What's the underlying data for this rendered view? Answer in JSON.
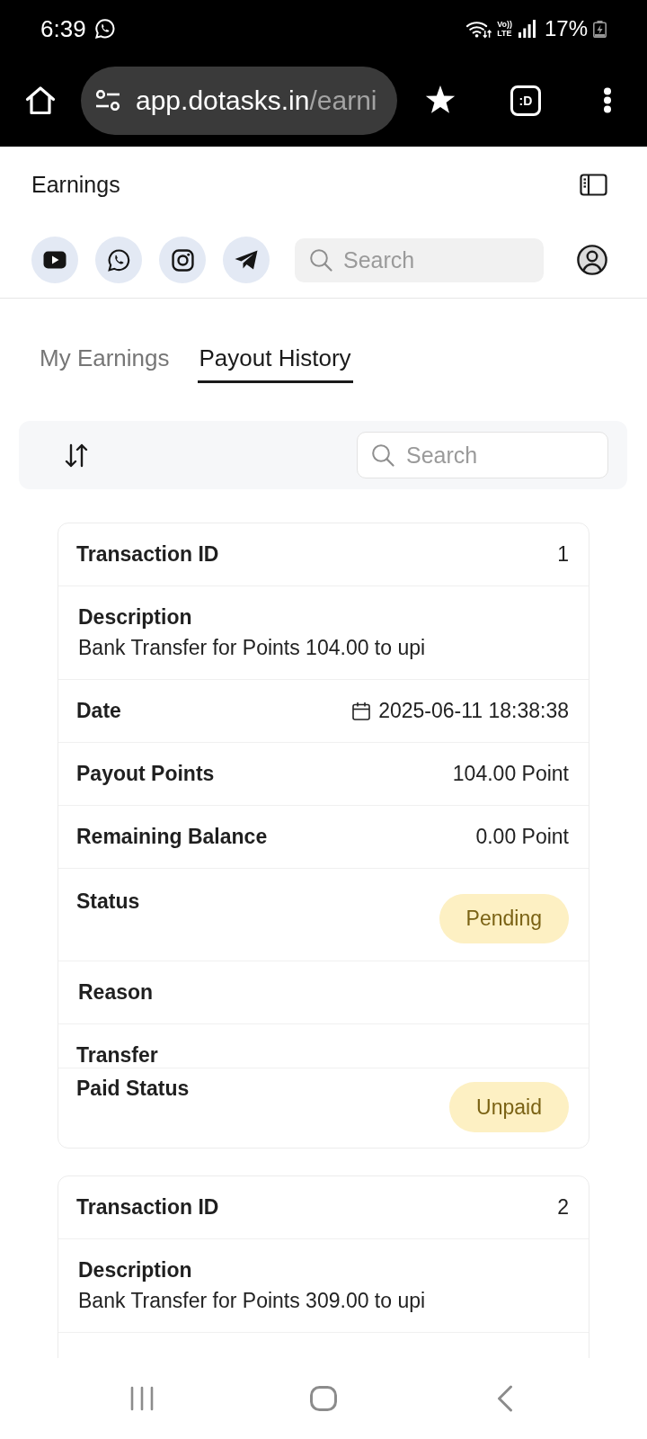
{
  "status_bar": {
    "time": "6:39",
    "network": [
      "Vo))",
      "LTE"
    ],
    "battery": "17%"
  },
  "browser": {
    "url_host": "app.dotasks.in",
    "url_path": "/earni",
    "tab_label": ":D"
  },
  "header": {
    "title": "Earnings",
    "social_links": [
      {
        "kind": "youtube"
      },
      {
        "kind": "whatsapp"
      },
      {
        "kind": "instagram"
      },
      {
        "kind": "telegram"
      }
    ],
    "search": {
      "placeholder": "Search"
    }
  },
  "tabs": [
    {
      "label": "My Earnings",
      "selected": false
    },
    {
      "label": "Payout History",
      "selected": true
    }
  ],
  "toolbar": {
    "search": {
      "placeholder": "Search"
    }
  },
  "payouts": [
    {
      "truncated": false,
      "fields": [
        {
          "kind": "text",
          "label": "Transaction ID",
          "value": "1"
        },
        {
          "kind": "stacked",
          "label": "Description",
          "value": "Bank Transfer for Points 104.00 to upi"
        },
        {
          "kind": "date",
          "label": "Date",
          "value": "2025-06-11 18:38:38"
        },
        {
          "kind": "text",
          "label": "Payout Points",
          "value": "104.00 Point"
        },
        {
          "kind": "text",
          "label": "Remaining Balance",
          "value": "0.00 Point"
        },
        {
          "kind": "badge",
          "label": "Status",
          "value": "Pending"
        },
        {
          "kind": "stacked",
          "label": "Reason"
        },
        {
          "kind": "stacked",
          "label": "Transfer",
          "overlapped": true
        },
        {
          "kind": "badge",
          "label": "Paid Status",
          "value": "Unpaid"
        }
      ]
    },
    {
      "truncated": true,
      "fields": [
        {
          "kind": "text",
          "label": "Transaction ID",
          "value": "2"
        },
        {
          "kind": "stacked",
          "label": "Description",
          "value": "Bank Transfer for Points 309.00 to upi"
        }
      ]
    }
  ]
}
